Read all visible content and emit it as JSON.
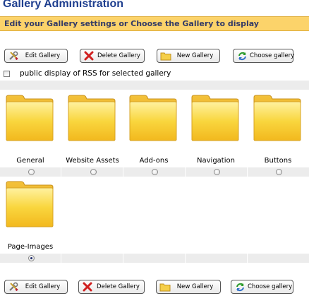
{
  "page": {
    "title": "Gallery Administration",
    "banner": "Edit your Gallery settings or Choose the Gallery to display"
  },
  "toolbar_top": {
    "edit": "Edit Gallery",
    "delete": "Delete Gallery",
    "new": "New Gallery",
    "choose": "Choose gallery"
  },
  "toolbar_bottom": {
    "edit": "Edit Gallery",
    "delete": "Delete Gallery",
    "new": "New Gallery",
    "choose": "Choose gallery"
  },
  "rss": {
    "label": "public display of RSS for selected gallery",
    "checked": false
  },
  "galleries": [
    {
      "label": "General",
      "selected": false
    },
    {
      "label": "Website Assets",
      "selected": false
    },
    {
      "label": "Add-ons",
      "selected": false
    },
    {
      "label": "Navigation",
      "selected": false
    },
    {
      "label": "Buttons",
      "selected": false
    },
    {
      "label": "Page-Images",
      "selected": true
    }
  ],
  "colors": {
    "title": "#1f3f8f",
    "banner": "#fcd36a",
    "folder": "#f9d23c"
  }
}
